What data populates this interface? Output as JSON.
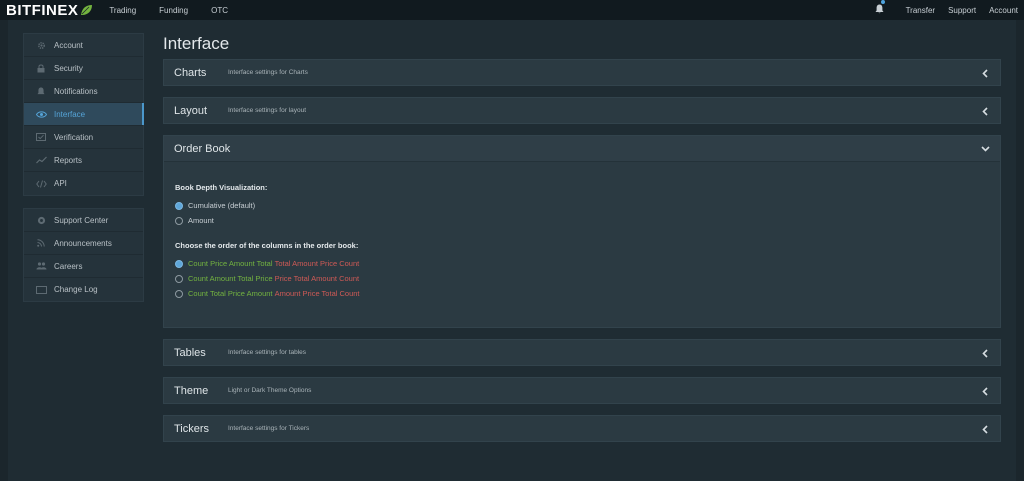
{
  "brand": {
    "name": "BITFINEX",
    "accent": "#74b43f"
  },
  "topnav": {
    "items": [
      "Trading",
      "Funding",
      "OTC"
    ]
  },
  "topright": {
    "links": [
      "Transfer",
      "Support",
      "Account"
    ]
  },
  "sidebar": {
    "group1": [
      {
        "label": "Account",
        "icon": "gear-icon"
      },
      {
        "label": "Security",
        "icon": "lock-icon"
      },
      {
        "label": "Notifications",
        "icon": "bell-icon"
      },
      {
        "label": "Interface",
        "icon": "eye-icon",
        "active": true
      },
      {
        "label": "Verification",
        "icon": "check-icon"
      },
      {
        "label": "Reports",
        "icon": "chart-icon"
      },
      {
        "label": "API",
        "icon": "code-icon"
      }
    ],
    "group2": [
      {
        "label": "Support Center",
        "icon": "lifebuoy-icon"
      },
      {
        "label": "Announcements",
        "icon": "rss-icon"
      },
      {
        "label": "Careers",
        "icon": "users-icon"
      },
      {
        "label": "Change Log",
        "icon": "list-icon"
      }
    ]
  },
  "page": {
    "title": "Interface"
  },
  "panels_top": [
    {
      "title": "Charts",
      "desc": "Interface settings for Charts"
    },
    {
      "title": "Layout",
      "desc": "Interface settings for layout"
    }
  ],
  "orderbook": {
    "title": "Order Book",
    "depth_label": "Book Depth Visualization:",
    "depth_options": [
      {
        "label": "Cumulative (default)",
        "selected": true
      },
      {
        "label": "Amount",
        "selected": false
      }
    ],
    "order_label": "Choose the order of the columns in the order book:",
    "order_options": [
      {
        "green": "Count Price Amount Total",
        "red": "Total Amount Price Count",
        "selected": true
      },
      {
        "green": "Count Amount Total Price",
        "red": "Price Total Amount Count",
        "selected": false
      },
      {
        "green": "Count Total Price Amount",
        "red": "Amount Price Total Count",
        "selected": false
      }
    ]
  },
  "panels_bottom": [
    {
      "title": "Tables",
      "desc": "Interface settings for tables"
    },
    {
      "title": "Theme",
      "desc": "Light or Dark Theme Options"
    },
    {
      "title": "Tickers",
      "desc": "Interface settings for Tickers"
    }
  ],
  "colors": {
    "bid_green": "#73b340",
    "ask_red": "#cf5a56",
    "active_blue": "#55a4d8"
  }
}
